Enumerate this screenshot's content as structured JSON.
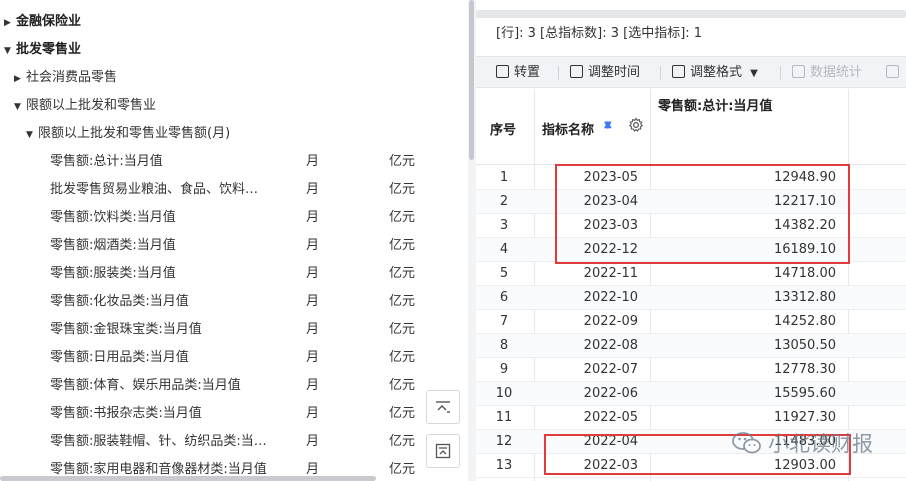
{
  "tree": {
    "cut_label": "……",
    "nodes": [
      {
        "label": "金融保险业",
        "arrow": "▶"
      },
      {
        "label": "批发零售业",
        "arrow": "▼"
      },
      {
        "label": "社会消费品零售",
        "arrow": "▶"
      },
      {
        "label": "限额以上批发和零售业",
        "arrow": "▼"
      },
      {
        "label": "限额以上批发和零售业零售额(月)",
        "arrow": "▼"
      }
    ],
    "leaves": [
      {
        "name": "零售额:总计:当月值",
        "freq": "月",
        "unit": "亿元"
      },
      {
        "name": "批发零售贸易业粮油、食品、饮料…",
        "freq": "月",
        "unit": "亿元"
      },
      {
        "name": "零售额:饮料类:当月值",
        "freq": "月",
        "unit": "亿元"
      },
      {
        "name": "零售额:烟酒类:当月值",
        "freq": "月",
        "unit": "亿元"
      },
      {
        "name": "零售额:服装类:当月值",
        "freq": "月",
        "unit": "亿元"
      },
      {
        "name": "零售额:化妆品类:当月值",
        "freq": "月",
        "unit": "亿元"
      },
      {
        "name": "零售额:金银珠宝类:当月值",
        "freq": "月",
        "unit": "亿元"
      },
      {
        "name": "零售额:日用品类:当月值",
        "freq": "月",
        "unit": "亿元"
      },
      {
        "name": "零售额:体育、娱乐用品类:当月值",
        "freq": "月",
        "unit": "亿元"
      },
      {
        "name": "零售额:书报杂志类:当月值",
        "freq": "月",
        "unit": "亿元"
      },
      {
        "name": "零售额:服装鞋帽、针、纺织品类:当…",
        "freq": "月",
        "unit": "亿元"
      },
      {
        "name": "零售额:家用电器和音像器材类:当月值",
        "freq": "月",
        "unit": "亿元"
      }
    ]
  },
  "stats": "[行]: 3 [总指标数]: 3 [选中指标]: 1",
  "toolbar": {
    "transpose": "转置",
    "adjust_time": "调整时间",
    "adjust_format": "调整格式",
    "format_arrow": "▼",
    "data_stats": "数据统计"
  },
  "grid": {
    "col_index": "序号",
    "col_name": "指标名称",
    "col_value": "零售额:总计:当月值",
    "rows": [
      {
        "i": "1",
        "d": "2023-05",
        "v": "12948.90"
      },
      {
        "i": "2",
        "d": "2023-04",
        "v": "12217.10"
      },
      {
        "i": "3",
        "d": "2023-03",
        "v": "14382.20"
      },
      {
        "i": "4",
        "d": "2022-12",
        "v": "16189.10"
      },
      {
        "i": "5",
        "d": "2022-11",
        "v": "14718.00"
      },
      {
        "i": "6",
        "d": "2022-10",
        "v": "13312.80"
      },
      {
        "i": "7",
        "d": "2022-09",
        "v": "14252.80"
      },
      {
        "i": "8",
        "d": "2022-08",
        "v": "13050.50"
      },
      {
        "i": "9",
        "d": "2022-07",
        "v": "12778.30"
      },
      {
        "i": "10",
        "d": "2022-06",
        "v": "15595.60"
      },
      {
        "i": "11",
        "d": "2022-05",
        "v": "11927.30"
      },
      {
        "i": "12",
        "d": "2022-04",
        "v": "11483.00"
      },
      {
        "i": "13",
        "d": "2022-03",
        "v": "12903.00"
      }
    ]
  },
  "watermark": "小北读财报",
  "colors": {
    "highlight": "#e03c3c",
    "accent": "#3b7cf6"
  }
}
